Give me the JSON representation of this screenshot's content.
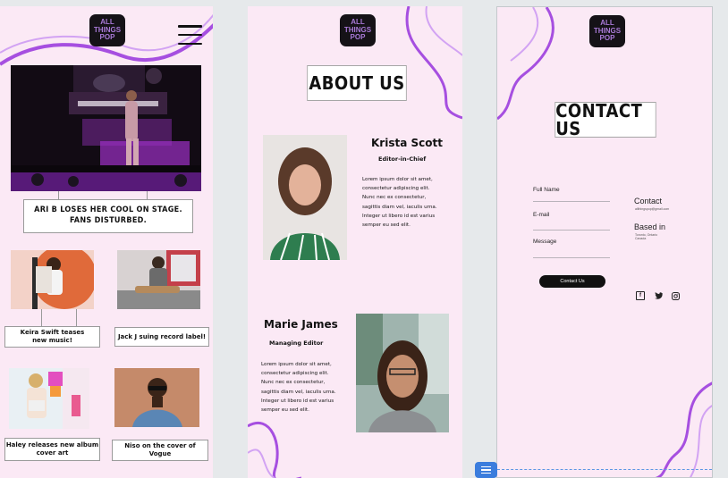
{
  "home": {
    "logo_text": "ALL\nTHINGS\nPOP",
    "hero_headline": "ARI B LOSES HER COOL ON STAGE.\nFANS DISTURBED.",
    "articles": [
      {
        "caption": "Keira Swift teases\nnew music!"
      },
      {
        "caption": "Jack J suing record label!"
      },
      {
        "caption": "Haley releases new album cover art"
      },
      {
        "caption": "Niso on the cover of Vogue"
      }
    ]
  },
  "about": {
    "logo_text": "ALL\nTHINGS\nPOP",
    "title": "ABOUT US",
    "people": [
      {
        "name": "Krista Scott",
        "role": "Editor-in-Chief",
        "bio": "Lorem ipsum dolor sit amet,\nconsectetur adipiscing elit.\nNunc nec ex consectetur,\nsagittis diam vel, iaculis urna.\nInteger ut libero id est varius\nsemper eu sed elit."
      },
      {
        "name": "Marie James",
        "role": "Managing Editor",
        "bio": "Lorem ipsum dolor sit amet,\nconsectetur adipiscing elit.\nNunc nec ex consectetur,\nsagittis diam vel, iaculis urna.\nInteger ut libero id est varius\nsemper eu sed elit."
      }
    ]
  },
  "contact": {
    "logo_text": "ALL\nTHINGS\nPOP",
    "title": "CONTACT US",
    "form": {
      "full_name_label": "Full Name",
      "email_label": "E-mail",
      "message_label": "Message",
      "submit_label": "Contact Us"
    },
    "info": {
      "contact_title": "Contact",
      "contact_email": "allthingspop@gmail.com",
      "based_title": "Based in",
      "based_location": "Toronto, Ontario\nCanada"
    },
    "social_icons": [
      "facebook-icon",
      "twitter-icon",
      "instagram-icon"
    ]
  },
  "colors": {
    "page_bg": "#fbe9f5",
    "accent_purple": "#a64fe0",
    "logo_bg": "#151217",
    "selection_blue": "#3b7ddd"
  }
}
